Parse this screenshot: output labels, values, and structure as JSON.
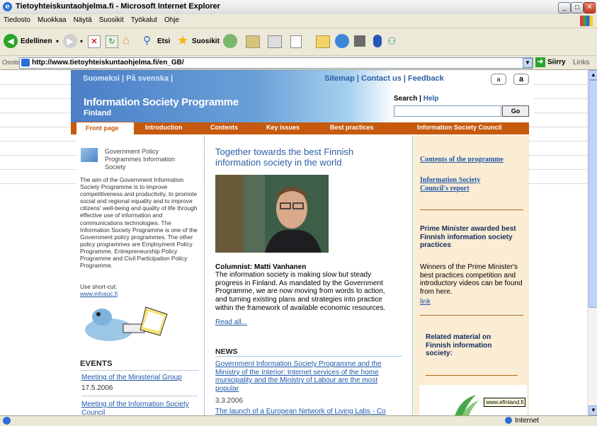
{
  "window": {
    "title": "Tietoyhteiskuntaohjelma.fi - Microsoft Internet Explorer",
    "minimize": "_",
    "maximize": "□",
    "close": "✕"
  },
  "menu": [
    "Tiedosto",
    "Muokkaa",
    "Näytä",
    "Suosikit",
    "Työkalut",
    "Ohje"
  ],
  "toolbar": {
    "back_label": "Edellinen",
    "search_label": "Etsi",
    "favorites_label": "Suosikit"
  },
  "address": {
    "label": "Osoite",
    "url": "http://www.tietoyhteiskuntaohjelma.fi/en_GB/",
    "go_label": "Siirry",
    "links_label": "Links"
  },
  "page": {
    "lang_links": "Suomeksi | På svenska |",
    "top_nav": {
      "sitemap": "Sitemap",
      "contact": "Contact us",
      "feedback": "Feedback"
    },
    "site_title": "Information Society Programme",
    "site_subtitle": "Finland",
    "search_label": "Search",
    "help_label": "Help",
    "search_go": "Go",
    "nav_tabs": [
      "Front page",
      "Introduction",
      "Contents",
      "Key issues",
      "Best practices",
      "Information Society Council"
    ],
    "left": {
      "gpp_title": "Government Policy Programmes Information Society",
      "body": "The aim of the Government Information Society Programme is to improve competitiveness and productivity, to promote social and regional equality and to improve citizens' well-being and quality of life through effective use of information and communications technologies. The Information Society Programme is one of the Government policy programmes. The other policy programmes are Employment Policy Programme, Entrepreneurship Policy Programme and Civil Participation Policy Programme.",
      "shortcut_label": "Use short-cut:",
      "shortcut_link": "www.infosoc.fi",
      "events_heading": "EVENTS",
      "events": [
        {
          "title": "Meeting of the Ministerial Group",
          "date": "17.5.2006"
        },
        {
          "title": "Meeting of the Information Society Council"
        }
      ]
    },
    "center": {
      "feature_title": "Together towards the best Finnish information society in the world",
      "columnist": "Columnist: Matti Vanhanen",
      "column_text": "The information society is making slow but steady progress in Finland. As mandated by the Government Programme, we are now moving from words to action, and turning existing plans and strategies into practice within the framework of available economic resources.",
      "read_all": "Read all...",
      "news_heading": "NEWS",
      "news": [
        {
          "title": "Government Information Society Programme and the Ministry of the Interior: Internet services of the home municipality and the Ministry of Labour are the most popular",
          "date": "3.3.2006"
        },
        {
          "title": "The launch of a European Network of Living Labs - Co"
        }
      ]
    },
    "right": {
      "link1": "Contents of the programme",
      "link2": "Information Society Council's report",
      "pm_heading": "Prime Minister awarded best Finnish information society practices",
      "pm_text": "Winners of the Prime Minister's best practices competition and introductory videos can be found from here.",
      "pm_link": "link",
      "related_heading": "Related material on Finnish information society:"
    },
    "tooltip": "www.efinland.fi"
  },
  "status": {
    "zone": "Internet"
  },
  "colors": {
    "accent_orange": "#c55a0e",
    "link_blue": "#1e58a8",
    "right_panel": "#fbecd4"
  }
}
